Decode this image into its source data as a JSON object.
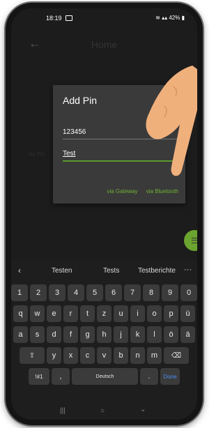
{
  "status": {
    "time": "18:19",
    "battery": "42%"
  },
  "app": {
    "title": "Home",
    "empty_left": "No Pin",
    "empty_right": ""
  },
  "dialog": {
    "title": "Add Pin",
    "pin_value": "123456",
    "name_value": "Test",
    "action_gateway": "via Gateway",
    "action_bluetooth": "via Bluetooth",
    "accent": "#6fb333"
  },
  "keyboard": {
    "suggestions": [
      "Testen",
      "Tests",
      "Testberichte"
    ],
    "more": "···",
    "row_numbers": [
      "1",
      "2",
      "3",
      "4",
      "5",
      "6",
      "7",
      "8",
      "9",
      "0"
    ],
    "row_1": [
      "q",
      "w",
      "e",
      "r",
      "t",
      "z",
      "u",
      "i",
      "o",
      "p",
      "ü"
    ],
    "row_2": [
      "a",
      "s",
      "d",
      "f",
      "g",
      "h",
      "j",
      "k",
      "l",
      "ö",
      "ä"
    ],
    "row_3": [
      "y",
      "x",
      "c",
      "v",
      "b",
      "n",
      "m"
    ],
    "symbols": "!#1",
    "comma": ",",
    "space": "Deutsch",
    "period": ".",
    "done": "Done"
  }
}
